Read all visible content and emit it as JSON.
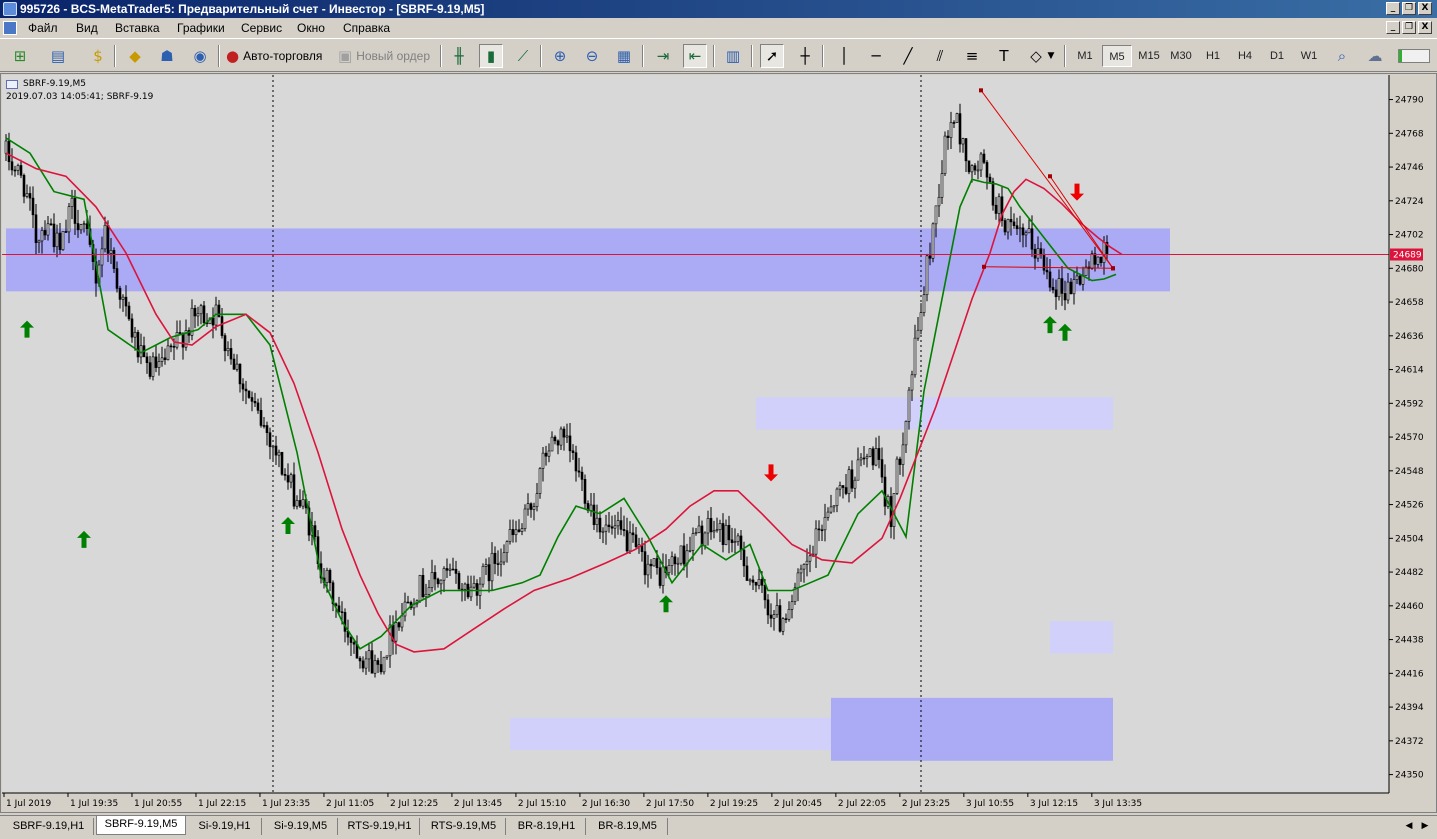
{
  "window": {
    "title": "995726 - BCS-MetaTrader5: Предварительный счет - Инвестор - [SBRF-9.19,M5]",
    "controls": [
      "_",
      "❐",
      "X"
    ],
    "mdi_controls": [
      "_",
      "❐",
      "X"
    ]
  },
  "menu": {
    "items": [
      "Файл",
      "Вид",
      "Вставка",
      "Графики",
      "Сервис",
      "Окно",
      "Справка"
    ]
  },
  "toolbar": {
    "algo_trading_label": "Авто-торговля",
    "new_order_label": "Новый ордер",
    "timeframes": [
      "M1",
      "M5",
      "M15",
      "M30",
      "H1",
      "H4",
      "D1",
      "W1"
    ],
    "active_timeframe": "M5",
    "icons": [
      "new-chart-icon",
      "profiles-icon",
      "market-watch-icon",
      "navigator-icon",
      "data-window-icon",
      "signals-icon",
      "algo-trading-icon",
      "new-order-icon",
      "bar-chart-icon",
      "candlesticks-icon",
      "line-chart-icon",
      "zoom-in-icon",
      "zoom-out-icon",
      "tile-windows-icon",
      "autoscroll-icon",
      "chart-shift-icon",
      "indicators-icon",
      "cursor-icon",
      "crosshair-icon",
      "vertical-line-icon",
      "horizontal-line-icon",
      "trendline-icon",
      "equidistant-channel-icon",
      "fibonacci-icon",
      "text-icon",
      "shapes-icon",
      "search-icon",
      "chat-icon",
      "market-icon"
    ]
  },
  "chart": {
    "symbol_label": "SBRF-9.19,M5",
    "info_line": "2019.07.03 14:05:41; SBRF-9.19",
    "current_price_label": "24689",
    "colors": {
      "background": "#d8d8d8",
      "candle": "#000000",
      "fast_ma": "#008000",
      "slow_ma": "#dc143c",
      "zone_strong": "#aaaaf5",
      "zone_weak": "#d0d0fa",
      "price_line": "#dc143c",
      "arrow_up": "#008000",
      "arrow_down": "#ee0000"
    },
    "price_ticks": [
      "24790",
      "24768",
      "24746",
      "24724",
      "24702",
      "24680",
      "24658",
      "24636",
      "24614",
      "24592",
      "24570",
      "24548",
      "24526",
      "24504",
      "24482",
      "24460",
      "24438",
      "24416",
      "24394",
      "24372",
      "24350"
    ],
    "time_ticks": [
      "1 Jul 2019",
      "1 Jul 19:35",
      "1 Jul 20:55",
      "1 Jul 22:15",
      "1 Jul 23:35",
      "2 Jul 11:05",
      "2 Jul 12:25",
      "2 Jul 13:45",
      "2 Jul 15:10",
      "2 Jul 16:30",
      "2 Jul 17:50",
      "2 Jul 19:25",
      "2 Jul 20:45",
      "2 Jul 22:05",
      "2 Jul 23:25",
      "3 Jul 10:55",
      "3 Jul 12:15",
      "3 Jul 13:35"
    ]
  },
  "chart_data": {
    "type": "candlestick",
    "symbol": "SBRF-9.19",
    "timeframe": "M5",
    "ylim": [
      24338,
      24806
    ],
    "last_price": 24689,
    "close_path": [
      [
        0,
        24755
      ],
      [
        6,
        24735
      ],
      [
        10,
        24700
      ],
      [
        14,
        24712
      ],
      [
        18,
        24690
      ],
      [
        22,
        24720
      ],
      [
        26,
        24705
      ],
      [
        30,
        24675
      ],
      [
        33,
        24705
      ],
      [
        36,
        24680
      ],
      [
        40,
        24650
      ],
      [
        46,
        24615
      ],
      [
        52,
        24615
      ],
      [
        58,
        24635
      ],
      [
        64,
        24650
      ],
      [
        70,
        24650
      ],
      [
        76,
        24620
      ],
      [
        82,
        24590
      ],
      [
        88,
        24570
      ],
      [
        94,
        24540
      ],
      [
        100,
        24520
      ],
      [
        106,
        24480
      ],
      [
        112,
        24450
      ],
      [
        118,
        24430
      ],
      [
        124,
        24420
      ],
      [
        130,
        24450
      ],
      [
        136,
        24470
      ],
      [
        142,
        24475
      ],
      [
        148,
        24480
      ],
      [
        154,
        24470
      ],
      [
        160,
        24480
      ],
      [
        166,
        24500
      ],
      [
        172,
        24510
      ],
      [
        176,
        24530
      ],
      [
        180,
        24560
      ],
      [
        184,
        24570
      ],
      [
        188,
        24560
      ],
      [
        192,
        24540
      ],
      [
        196,
        24520
      ],
      [
        200,
        24510
      ],
      [
        206,
        24505
      ],
      [
        212,
        24490
      ],
      [
        218,
        24480
      ],
      [
        224,
        24490
      ],
      [
        230,
        24505
      ],
      [
        236,
        24510
      ],
      [
        242,
        24505
      ],
      [
        248,
        24480
      ],
      [
        254,
        24460
      ],
      [
        258,
        24450
      ],
      [
        262,
        24465
      ],
      [
        268,
        24490
      ],
      [
        274,
        24525
      ],
      [
        280,
        24540
      ],
      [
        286,
        24555
      ],
      [
        290,
        24560
      ],
      [
        292,
        24535
      ],
      [
        295,
        24520
      ],
      [
        298,
        24560
      ],
      [
        301,
        24600
      ],
      [
        304,
        24640
      ],
      [
        307,
        24680
      ],
      [
        310,
        24720
      ],
      [
        313,
        24760
      ],
      [
        316,
        24780
      ],
      [
        319,
        24760
      ],
      [
        322,
        24740
      ],
      [
        325,
        24750
      ],
      [
        328,
        24730
      ],
      [
        332,
        24715
      ],
      [
        336,
        24700
      ],
      [
        340,
        24700
      ],
      [
        344,
        24690
      ],
      [
        348,
        24675
      ],
      [
        352,
        24665
      ],
      [
        356,
        24670
      ],
      [
        360,
        24680
      ],
      [
        364,
        24685
      ],
      [
        366,
        24700
      ],
      [
        367,
        24689
      ]
    ],
    "indicators": [
      {
        "name": "fast MA",
        "color": "green",
        "values": [
          [
            0,
            24765
          ],
          [
            8,
            24755
          ],
          [
            16,
            24730
          ],
          [
            26,
            24725
          ],
          [
            34,
            24640
          ],
          [
            45,
            24625
          ],
          [
            55,
            24635
          ],
          [
            64,
            24640
          ],
          [
            70,
            24650
          ],
          [
            80,
            24650
          ],
          [
            88,
            24630
          ],
          [
            97,
            24560
          ],
          [
            105,
            24480
          ],
          [
            112,
            24450
          ],
          [
            118,
            24432
          ],
          [
            125,
            24440
          ],
          [
            135,
            24460
          ],
          [
            145,
            24470
          ],
          [
            155,
            24470
          ],
          [
            162,
            24470
          ],
          [
            172,
            24475
          ],
          [
            178,
            24480
          ],
          [
            184,
            24505
          ],
          [
            190,
            24525
          ],
          [
            198,
            24520
          ],
          [
            206,
            24530
          ],
          [
            214,
            24505
          ],
          [
            222,
            24475
          ],
          [
            232,
            24500
          ],
          [
            240,
            24490
          ],
          [
            248,
            24500
          ],
          [
            254,
            24470
          ],
          [
            262,
            24470
          ],
          [
            268,
            24475
          ],
          [
            274,
            24480
          ],
          [
            284,
            24520
          ],
          [
            292,
            24535
          ],
          [
            300,
            24505
          ],
          [
            306,
            24600
          ],
          [
            310,
            24640
          ],
          [
            314,
            24680
          ],
          [
            318,
            24720
          ],
          [
            322,
            24738
          ],
          [
            326,
            24736
          ],
          [
            330,
            24735
          ],
          [
            334,
            24732
          ],
          [
            338,
            24720
          ],
          [
            342,
            24710
          ],
          [
            346,
            24700
          ],
          [
            350,
            24690
          ],
          [
            354,
            24680
          ],
          [
            358,
            24676
          ],
          [
            362,
            24672
          ],
          [
            366,
            24673
          ],
          [
            370,
            24676
          ]
        ]
      },
      {
        "name": "slow MA",
        "color": "crimson",
        "values": [
          [
            0,
            24755
          ],
          [
            10,
            24745
          ],
          [
            20,
            24740
          ],
          [
            30,
            24720
          ],
          [
            40,
            24690
          ],
          [
            50,
            24650
          ],
          [
            56,
            24632
          ],
          [
            62,
            24630
          ],
          [
            70,
            24642
          ],
          [
            80,
            24650
          ],
          [
            88,
            24638
          ],
          [
            96,
            24605
          ],
          [
            104,
            24560
          ],
          [
            112,
            24510
          ],
          [
            118,
            24480
          ],
          [
            124,
            24455
          ],
          [
            130,
            24435
          ],
          [
            136,
            24430
          ],
          [
            146,
            24432
          ],
          [
            156,
            24445
          ],
          [
            166,
            24458
          ],
          [
            176,
            24470
          ],
          [
            188,
            24478
          ],
          [
            200,
            24488
          ],
          [
            210,
            24497
          ],
          [
            220,
            24510
          ],
          [
            228,
            24525
          ],
          [
            236,
            24535
          ],
          [
            244,
            24535
          ],
          [
            252,
            24520
          ],
          [
            262,
            24500
          ],
          [
            272,
            24490
          ],
          [
            282,
            24488
          ],
          [
            292,
            24504
          ],
          [
            298,
            24530
          ],
          [
            304,
            24560
          ],
          [
            310,
            24590
          ],
          [
            316,
            24625
          ],
          [
            322,
            24660
          ],
          [
            328,
            24690
          ],
          [
            332,
            24715
          ],
          [
            336,
            24730
          ],
          [
            340,
            24738
          ],
          [
            346,
            24732
          ],
          [
            352,
            24722
          ],
          [
            358,
            24710
          ],
          [
            364,
            24700
          ],
          [
            368,
            24694
          ],
          [
            372,
            24689
          ]
        ]
      }
    ],
    "zones": [
      {
        "from_bar": 0,
        "to_bar": 388,
        "top": 24706,
        "bottom": 24665,
        "strength": "strong"
      },
      {
        "from_bar": 250,
        "to_bar": 369,
        "top": 24596,
        "bottom": 24575,
        "strength": "weak"
      },
      {
        "from_bar": 348,
        "to_bar": 369,
        "top": 24450,
        "bottom": 24429,
        "strength": "weak"
      },
      {
        "from_bar": 275,
        "to_bar": 369,
        "top": 24400,
        "bottom": 24359,
        "strength": "strong"
      },
      {
        "from_bar": 168,
        "to_bar": 275,
        "top": 24387,
        "bottom": 24366,
        "strength": "weak"
      }
    ],
    "arrows": [
      {
        "dir": "up",
        "bar": 7,
        "price": 24640
      },
      {
        "dir": "up",
        "bar": 26,
        "price": 24503
      },
      {
        "dir": "up",
        "bar": 94,
        "price": 24512
      },
      {
        "dir": "up",
        "bar": 220,
        "price": 24461
      },
      {
        "dir": "down",
        "bar": 255,
        "price": 24547
      },
      {
        "dir": "down",
        "bar": 357,
        "price": 24730
      },
      {
        "dir": "up",
        "bar": 348,
        "price": 24643
      },
      {
        "dir": "up",
        "bar": 353,
        "price": 24638
      }
    ],
    "period_separators_bars": [
      89,
      305
    ],
    "trend_objects": [
      {
        "from": [
          325,
          24796
        ],
        "to": [
          369,
          24680
        ],
        "color": "red"
      },
      {
        "from": [
          348,
          24740
        ],
        "to": [
          369,
          24680
        ],
        "color": "red"
      },
      {
        "from": [
          326,
          24681
        ],
        "to": [
          369,
          24680
        ],
        "color": "red"
      }
    ]
  },
  "tabs": {
    "items": [
      "SBRF-9.19,H1",
      "SBRF-9.19,M5",
      "Si-9.19,H1",
      "Si-9.19,M5",
      "RTS-9.19,H1",
      "RTS-9.19,M5",
      "BR-8.19,H1",
      "BR-8.19,M5"
    ],
    "active_index": 1
  }
}
